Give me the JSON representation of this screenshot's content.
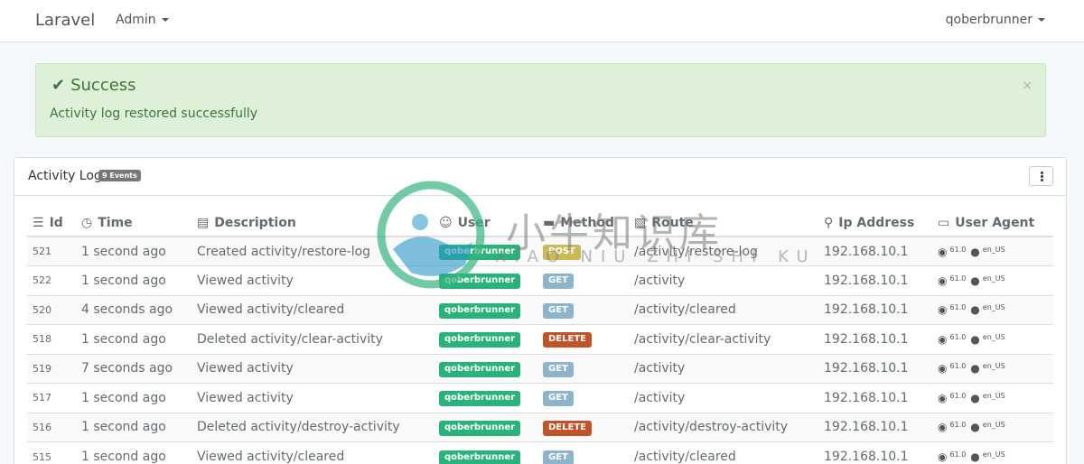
{
  "navbar": {
    "brand": "Laravel",
    "admin_label": "Admin",
    "user_label": "qoberbrunner"
  },
  "alert": {
    "title": "Success",
    "message": "Activity log restored successfully",
    "close": "×"
  },
  "panel": {
    "title": "Activity Log",
    "badge": "9 Events"
  },
  "table": {
    "headers": {
      "id": "Id",
      "time": "Time",
      "description": "Description",
      "user": "User",
      "method": "Method",
      "route": "Route",
      "ip": "Ip Address",
      "agent": "User Agent"
    },
    "rows": [
      {
        "id": "521",
        "time": "1 second ago",
        "description": "Created activity/restore-log",
        "user": "qoberbrunner",
        "method": "POST",
        "route": "/activity/restore-log",
        "ip": "192.168.10.1",
        "version": "61.0",
        "lang": "en_US"
      },
      {
        "id": "522",
        "time": "1 second ago",
        "description": "Viewed activity",
        "user": "qoberbrunner",
        "method": "GET",
        "route": "/activity",
        "ip": "192.168.10.1",
        "version": "61.0",
        "lang": "en_US"
      },
      {
        "id": "520",
        "time": "4 seconds ago",
        "description": "Viewed activity/cleared",
        "user": "qoberbrunner",
        "method": "GET",
        "route": "/activity/cleared",
        "ip": "192.168.10.1",
        "version": "61.0",
        "lang": "en_US"
      },
      {
        "id": "518",
        "time": "1 second ago",
        "description": "Deleted activity/clear-activity",
        "user": "qoberbrunner",
        "method": "DELETE",
        "route": "/activity/clear-activity",
        "ip": "192.168.10.1",
        "version": "61.0",
        "lang": "en_US"
      },
      {
        "id": "519",
        "time": "7 seconds ago",
        "description": "Viewed activity",
        "user": "qoberbrunner",
        "method": "GET",
        "route": "/activity",
        "ip": "192.168.10.1",
        "version": "61.0",
        "lang": "en_US"
      },
      {
        "id": "517",
        "time": "1 second ago",
        "description": "Viewed activity",
        "user": "qoberbrunner",
        "method": "GET",
        "route": "/activity",
        "ip": "192.168.10.1",
        "version": "61.0",
        "lang": "en_US"
      },
      {
        "id": "516",
        "time": "1 second ago",
        "description": "Deleted activity/destroy-activity",
        "user": "qoberbrunner",
        "method": "DELETE",
        "route": "/activity/destroy-activity",
        "ip": "192.168.10.1",
        "version": "61.0",
        "lang": "en_US"
      },
      {
        "id": "515",
        "time": "1 second ago",
        "description": "Viewed activity/cleared",
        "user": "qoberbrunner",
        "method": "GET",
        "route": "/activity/cleared",
        "ip": "192.168.10.1",
        "version": "61.0",
        "lang": "en_US"
      }
    ]
  },
  "watermark": {
    "title": "小牛知识库",
    "subtitle": "XIAO NIU ZHI SHI KU"
  },
  "icons": {
    "browser": "chrome-icon",
    "os": "apple-icon"
  },
  "colors": {
    "success_bg": "#dff0d8",
    "user_label": "#2ab27b",
    "post_label": "#cbb956",
    "get_label": "#8eb4cb",
    "delete_label": "#bf5329"
  }
}
